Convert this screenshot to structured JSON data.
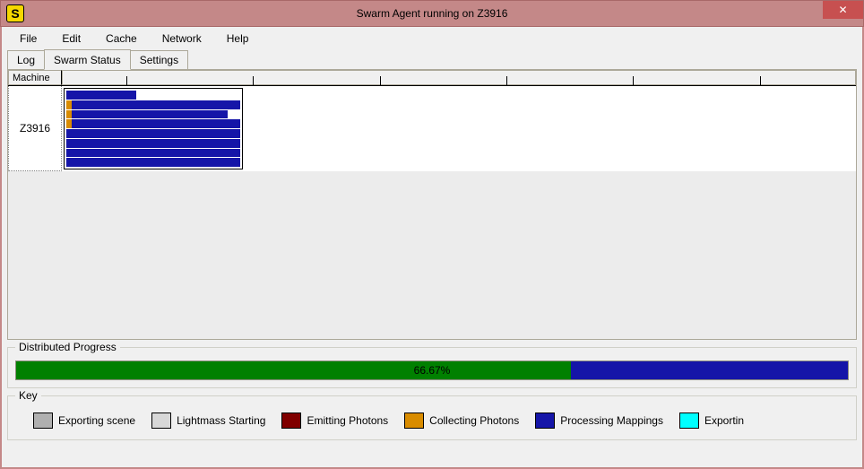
{
  "window": {
    "title": "Swarm Agent running on Z3916",
    "icon_letter": "S"
  },
  "menu": {
    "file": "File",
    "edit": "Edit",
    "cache": "Cache",
    "network": "Network",
    "help": "Help"
  },
  "tabs": {
    "log": "Log",
    "swarm_status": "Swarm Status",
    "settings": "Settings",
    "active": "swarm_status"
  },
  "grid": {
    "header_machine": "Machine",
    "machine_name": "Z3916",
    "rows": [
      {
        "collect": 0,
        "process": 40
      },
      {
        "collect": 3,
        "process": 97
      },
      {
        "collect": 3,
        "process": 90
      },
      {
        "collect": 3,
        "process": 97
      },
      {
        "collect": 0,
        "process": 100
      },
      {
        "collect": 0,
        "process": 100
      },
      {
        "collect": 0,
        "process": 100
      },
      {
        "collect": 0,
        "process": 100
      }
    ],
    "ticks_percent": [
      8,
      24,
      40,
      56,
      72,
      88
    ]
  },
  "progress": {
    "label": "Distributed Progress",
    "percent": 66.67,
    "text": "66.67%",
    "remainder_color": "#1515a8"
  },
  "key": {
    "label": "Key",
    "items": [
      {
        "name": "exporting-scene",
        "label": "Exporting scene",
        "color": "#b0b0b0"
      },
      {
        "name": "lightmass-starting",
        "label": "Lightmass Starting",
        "color": "#d8d8d8"
      },
      {
        "name": "emitting-photons",
        "label": "Emitting Photons",
        "color": "#800000"
      },
      {
        "name": "collecting-photons",
        "label": "Collecting Photons",
        "color": "#d98c00"
      },
      {
        "name": "processing-mappings",
        "label": "Processing Mappings",
        "color": "#1515a8"
      },
      {
        "name": "exporting",
        "label": "Exportin",
        "color": "#00ffff"
      }
    ]
  }
}
